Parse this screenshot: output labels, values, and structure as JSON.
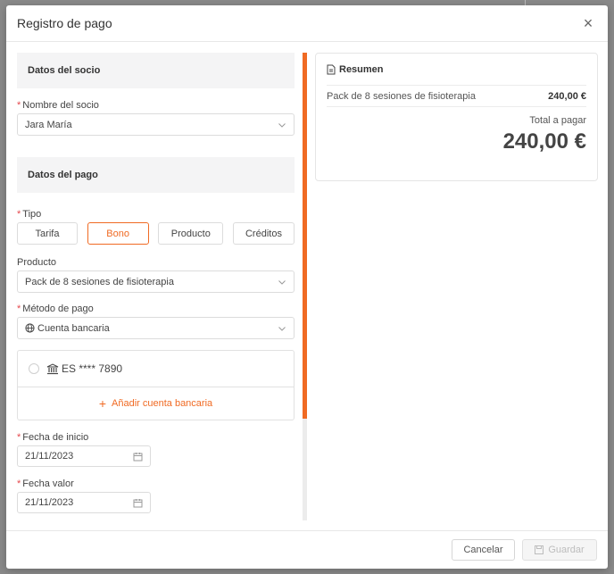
{
  "modal": {
    "title": "Registro de pago",
    "close_glyph": "×"
  },
  "member_section": {
    "title": "Datos del socio",
    "name_label": "Nombre del socio",
    "name_value": "Jara María"
  },
  "payment_section": {
    "title": "Datos del pago",
    "type_label": "Tipo",
    "type_options": [
      "Tarifa",
      "Bono",
      "Producto",
      "Créditos"
    ],
    "type_selected": "Bono",
    "product_label": "Producto",
    "product_value": "Pack de 8 sesiones de fisioterapia",
    "method_label": "Método de pago",
    "method_value": "Cuenta bancaria",
    "account": "ES **** 7890",
    "add_account": "Añadir cuenta bancaria",
    "start_date_label": "Fecha de inicio",
    "start_date_value": "21/11/2023",
    "value_date_label": "Fecha valor",
    "value_date_value": "21/11/2023"
  },
  "summary": {
    "title": "Resumen",
    "line_item": "Pack de 8 sesiones de fisioterapia",
    "line_amount": "240,00 €",
    "total_label": "Total a pagar",
    "total_amount": "240,00 €"
  },
  "footer": {
    "cancel_label": "Cancelar",
    "save_label": "Guardar"
  },
  "colors": {
    "accent": "#f06a23",
    "required": "#e5484d"
  }
}
